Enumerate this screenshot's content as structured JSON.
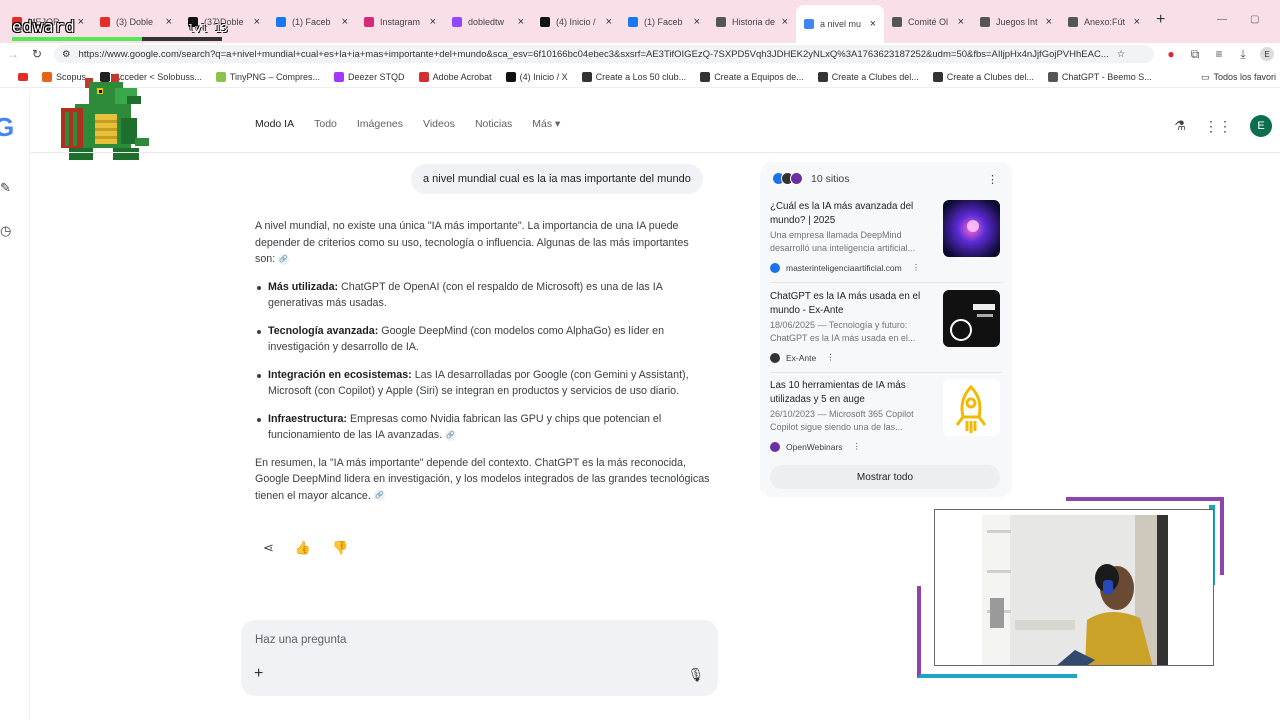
{
  "overlay": {
    "streamer_name": "edward",
    "level": "lvl 13",
    "xp_progress": 0.62
  },
  "browser": {
    "tabs": [
      {
        "title": "MEJOR",
        "icon": "youtube-icon",
        "color": "#e52d27"
      },
      {
        "title": "(3) Doble",
        "icon": "youtube-icon",
        "color": "#e52d27"
      },
      {
        "title": "(37)Doble",
        "icon": "tiktok-icon",
        "color": "#111111"
      },
      {
        "title": "(1) Faceb",
        "icon": "facebook-icon",
        "color": "#1877f2"
      },
      {
        "title": "Instagram",
        "icon": "instagram-icon",
        "color": "#d62976"
      },
      {
        "title": "dobledtw",
        "icon": "twitch-icon",
        "color": "#9146ff"
      },
      {
        "title": "(4) Inicio /",
        "icon": "x-icon",
        "color": "#111111"
      },
      {
        "title": "(1) Faceb",
        "icon": "facebook-icon",
        "color": "#1877f2"
      },
      {
        "title": "Historia de",
        "icon": "wikipedia-icon",
        "color": "#555555"
      },
      {
        "title": "a nivel mu",
        "icon": "google-icon",
        "color": "#4285f4",
        "active": true
      },
      {
        "title": "Comité Ol",
        "icon": "wikipedia-icon",
        "color": "#555555"
      },
      {
        "title": "Juegos Int",
        "icon": "wikipedia-icon",
        "color": "#555555"
      },
      {
        "title": "Anexo:Fút",
        "icon": "wikipedia-icon",
        "color": "#555555"
      }
    ],
    "new_tab": "+",
    "url": "https://www.google.com/search?q=a+nivel+mundial+cual+es+la+ia+mas+importante+del+mundo&sca_esv=6f10166bc04ebec3&sxsrf=AE3TifOIGEzQ-7SXPD5Vqh3JDHEK2yNLxQ%3A1763623187252&udm=50&fbs=AIljpHx4nJjfGojPVHhEAC...",
    "bookmarks": [
      {
        "label": "Scopus",
        "color": "#e8641b"
      },
      {
        "label": "Acceder < Solobuss...",
        "color": "#222222"
      },
      {
        "label": "TinyPNG – Compres...",
        "color": "#8bc34a"
      },
      {
        "label": "Deezer STQD",
        "color": "#a238ff"
      },
      {
        "label": "Adobe Acrobat",
        "color": "#d32f2f"
      },
      {
        "label": "(4) Inicio / X",
        "color": "#111111"
      },
      {
        "label": "Create a Los 50 club...",
        "color": "#333333"
      },
      {
        "label": "Create a Equipos de...",
        "color": "#333333"
      },
      {
        "label": "Create a Clubes del...",
        "color": "#333333"
      },
      {
        "label": "Create a Clubes del...",
        "color": "#333333"
      },
      {
        "label": "ChatGPT - Beemo S...",
        "color": "#555555"
      }
    ],
    "bookmarks_all": "Todos los favori"
  },
  "google": {
    "nav": [
      {
        "label": "Modo IA",
        "active": true
      },
      {
        "label": "Todo"
      },
      {
        "label": "Imágenes"
      },
      {
        "label": "Videos"
      },
      {
        "label": "Noticias"
      },
      {
        "label": "Más ▾"
      }
    ],
    "avatar_letter": "E",
    "query": "a nivel mundial cual es la ia mas importante del mundo",
    "intro": "A nivel mundial, no existe una única \"IA más importante\". La importancia de una IA puede depender de criterios como su uso, tecnología o influencia. Algunas de las más importantes son:",
    "bullets": [
      {
        "bold": "Más utilizada:",
        "text": " ChatGPT de OpenAI (con el respaldo de Microsoft) es una de las IA generativas más usadas."
      },
      {
        "bold": "Tecnología avanzada:",
        "text": " Google DeepMind (con modelos como AlphaGo) es líder en investigación y desarrollo de IA."
      },
      {
        "bold": "Integración en ecosistemas:",
        "text": " Las IA desarrolladas por Google (con Gemini y Assistant), Microsoft (con Copilot) y Apple (Siri) se integran en productos y servicios de uso diario."
      },
      {
        "bold": "Infraestructura:",
        "text": " Empresas como Nvidia fabrican las GPU y chips que potencian el funcionamiento de las IA avanzadas."
      }
    ],
    "summary": "En resumen, la \"IA más importante\" depende del contexto. ChatGPT es la más reconocida, Google DeepMind lidera en investigación, y los modelos integrados de las grandes tecnológicas tienen el mayor alcance.",
    "ask_placeholder": "Haz una pregunta",
    "sources": {
      "count_label": "10 sitios",
      "items": [
        {
          "title": "¿Cuál es la IA más avanzada del mundo? | 2025",
          "snippet": "Una empresa llamada DeepMind desarrolló una inteligencia artificial...",
          "site": "masterinteligenciaartificial.com",
          "site_color": "#1a73e8",
          "thumb": "galaxy"
        },
        {
          "title": "ChatGPT es la IA más usada en el mundo - Ex-Ante",
          "snippet": "18/06/2025 — Tecnología y futuro: ChatGPT es la IA más usada en el...",
          "site": "Ex-Ante",
          "site_color": "#333333",
          "thumb": "chatgpt"
        },
        {
          "title": "Las 10 herramientas de IA más utilizadas y 5 en auge",
          "snippet": "26/10/2023 — Microsoft 365 Copilot Copilot sigue siendo una de las...",
          "site": "OpenWebinars",
          "site_color": "#6b2fa3",
          "thumb": "rocket"
        }
      ],
      "show_all": "Mostrar todo"
    }
  }
}
